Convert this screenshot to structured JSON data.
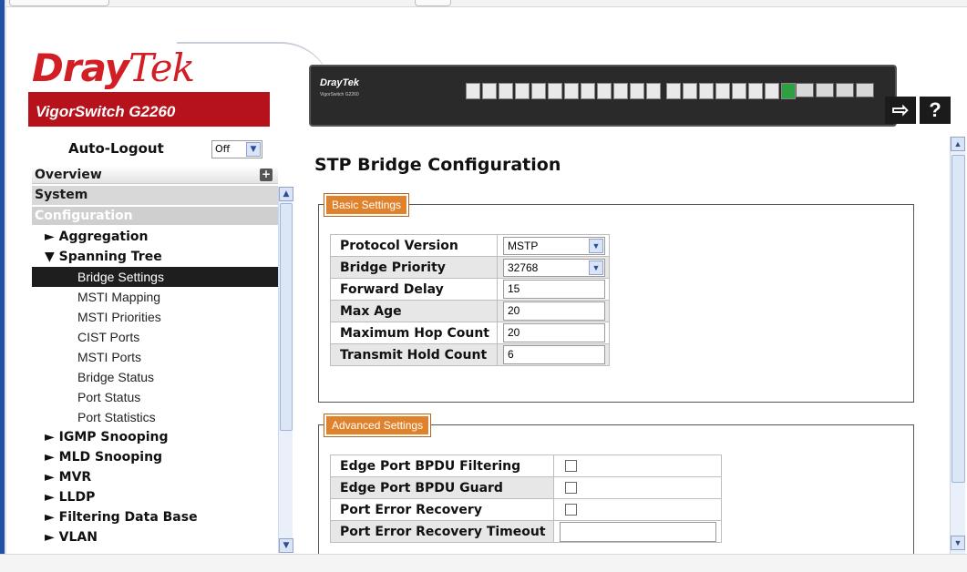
{
  "header": {
    "logo_left": "Dray",
    "logo_right": "Tek",
    "model": "VigorSwitch G2260",
    "panel_logo": "DrayTek",
    "panel_model": "VigorSwitch G2260",
    "arrow_icon": "exit-arrow-icon",
    "help_icon": "?"
  },
  "sidebar": {
    "autologout_label": "Auto-Logout",
    "autologout_value": "Off",
    "overview": "Overview",
    "system": "System",
    "configuration": "Configuration",
    "items": [
      {
        "label": "► Aggregation",
        "kind": "group"
      },
      {
        "label": "▼ Spanning Tree",
        "kind": "group"
      },
      {
        "label": "Bridge Settings",
        "kind": "sub",
        "active": true
      },
      {
        "label": "MSTI Mapping",
        "kind": "sub"
      },
      {
        "label": "MSTI Priorities",
        "kind": "sub"
      },
      {
        "label": "CIST Ports",
        "kind": "sub"
      },
      {
        "label": "MSTI Ports",
        "kind": "sub"
      },
      {
        "label": "Bridge Status",
        "kind": "sub"
      },
      {
        "label": "Port Status",
        "kind": "sub"
      },
      {
        "label": "Port Statistics",
        "kind": "sub"
      },
      {
        "label": "► IGMP Snooping",
        "kind": "group"
      },
      {
        "label": "► MLD Snooping",
        "kind": "group"
      },
      {
        "label": "► MVR",
        "kind": "group"
      },
      {
        "label": "► LLDP",
        "kind": "group"
      },
      {
        "label": "► Filtering Data Base",
        "kind": "group"
      },
      {
        "label": "► VLAN",
        "kind": "group"
      }
    ]
  },
  "main": {
    "title": "STP Bridge Configuration",
    "basic": {
      "legend": "Basic Settings",
      "protocol_version_label": "Protocol Version",
      "protocol_version_value": "MSTP",
      "bridge_priority_label": "Bridge Priority",
      "bridge_priority_value": "32768",
      "forward_delay_label": "Forward Delay",
      "forward_delay_value": "15",
      "max_age_label": "Max Age",
      "max_age_value": "20",
      "max_hop_label": "Maximum Hop Count",
      "max_hop_value": "20",
      "tx_hold_label": "Transmit Hold Count",
      "tx_hold_value": "6"
    },
    "advanced": {
      "legend": "Advanced Settings",
      "bpdu_filter_label": "Edge Port BPDU Filtering",
      "bpdu_guard_label": "Edge Port BPDU Guard",
      "err_recovery_label": "Port Error Recovery",
      "err_timeout_label": "Port Error Recovery Timeout"
    }
  }
}
